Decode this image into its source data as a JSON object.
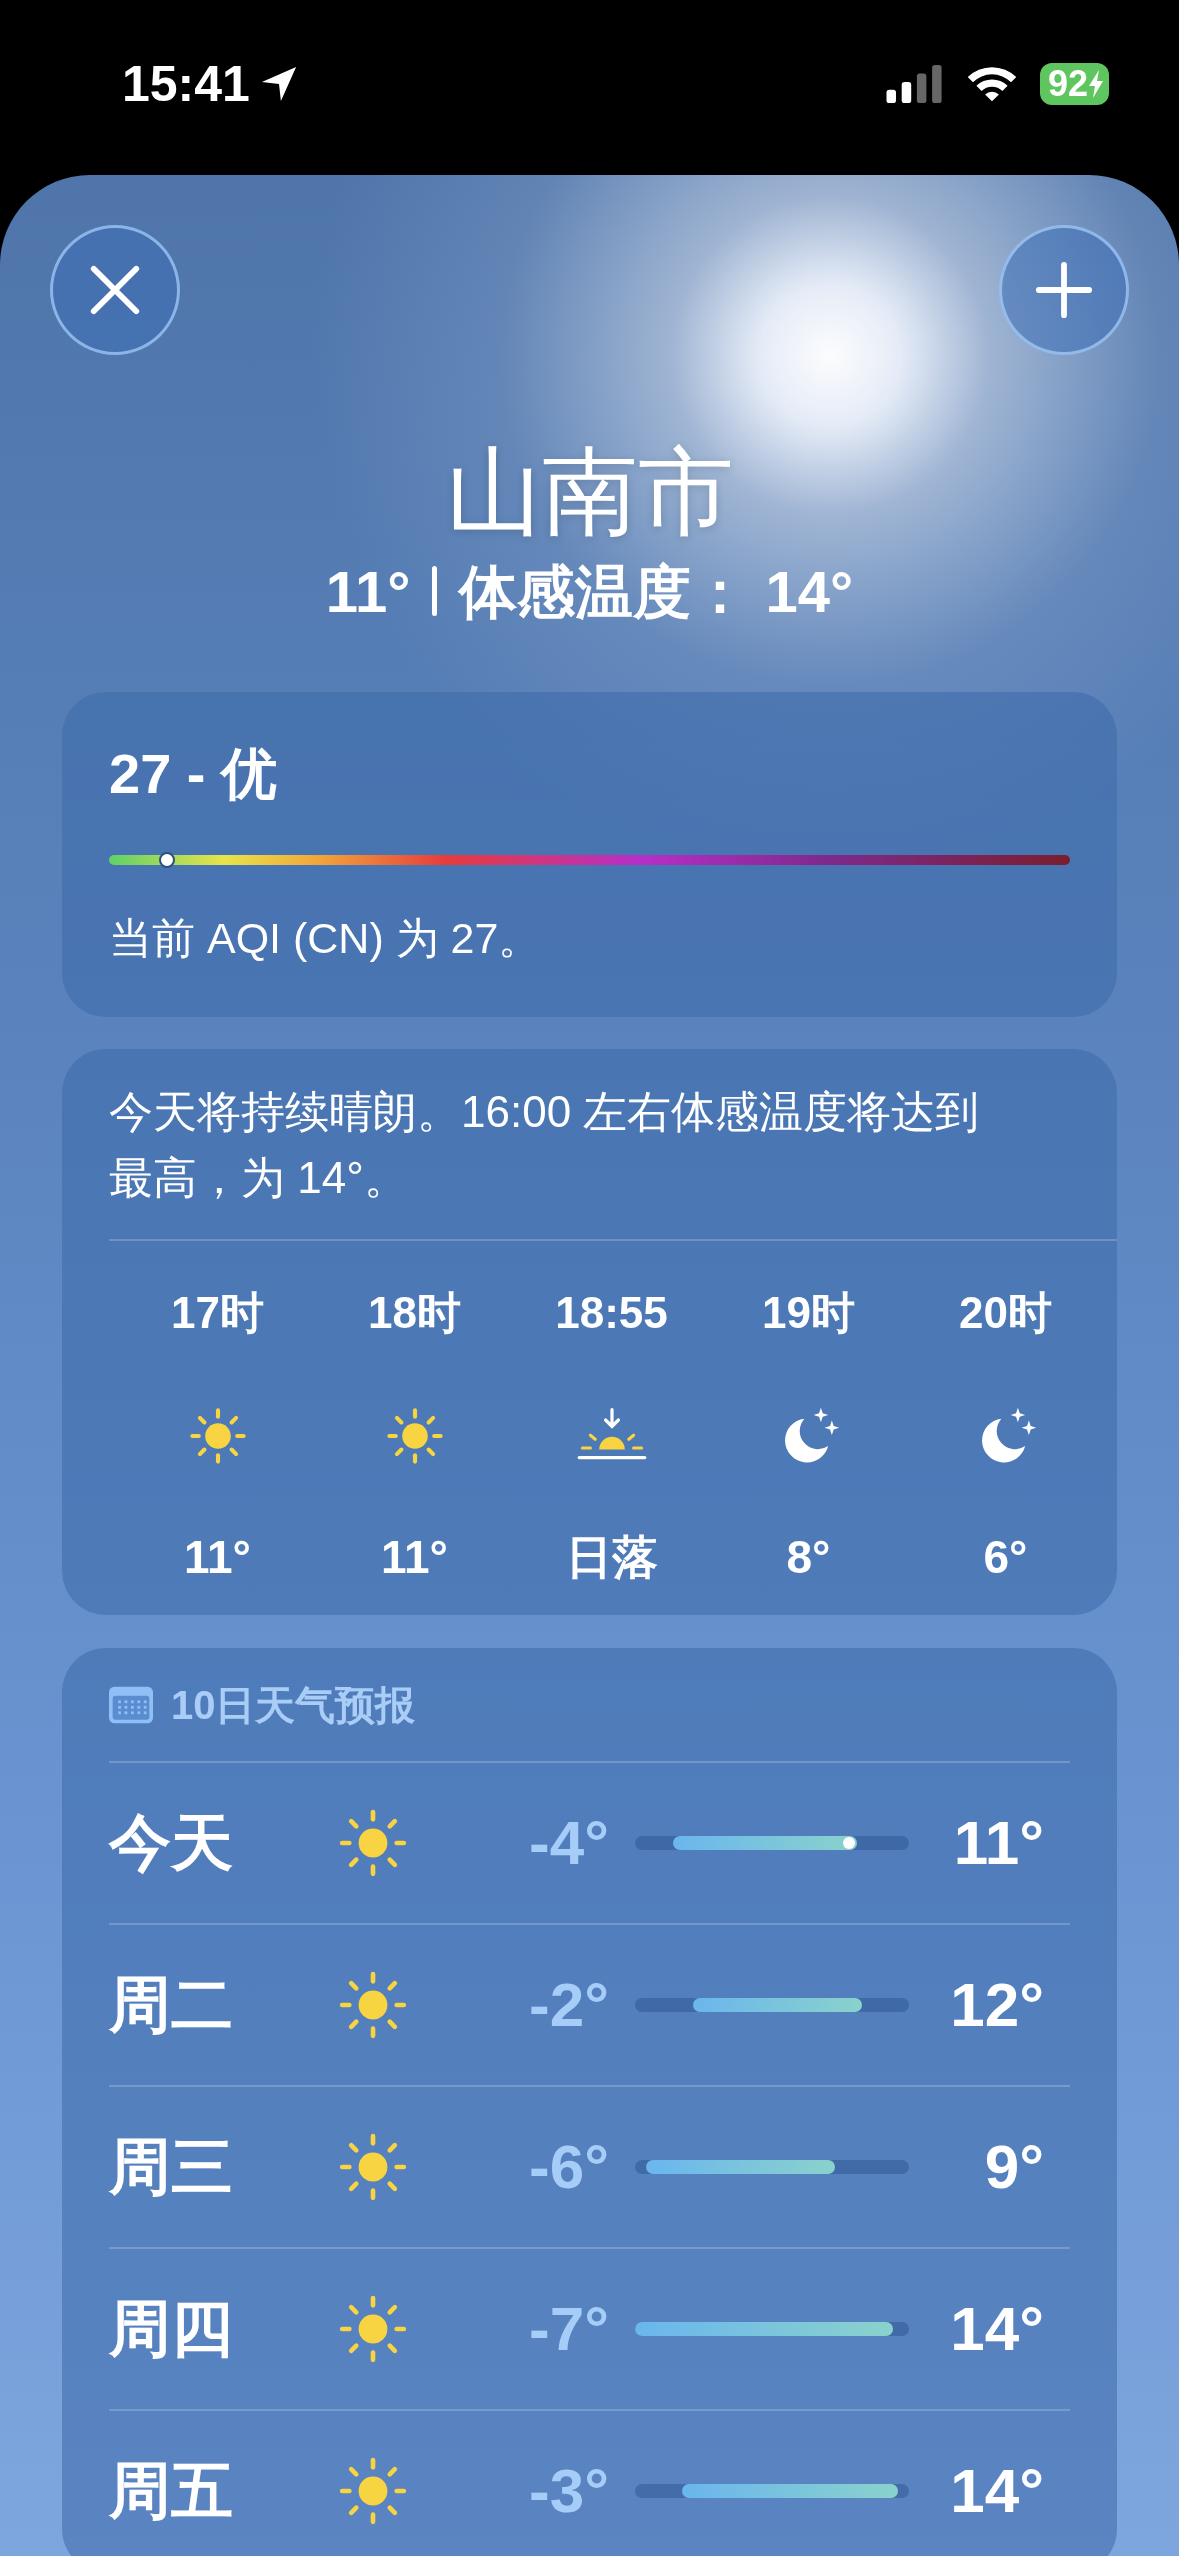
{
  "status_bar": {
    "time": "15:41",
    "battery": "92"
  },
  "location": {
    "city": "山南市",
    "temperature": "11°",
    "feels_like": "体感温度： 14°"
  },
  "air_quality": {
    "reading": "27 - 优",
    "description": "当前 AQI (CN) 为 27。",
    "scale": {
      "level": 0.06
    }
  },
  "hourly": {
    "summary": "今天将持续晴朗。16:00 左右体感温度将达到最高，为 14°。",
    "hours": [
      {
        "time": "17时",
        "kind": "sun",
        "value": "11°"
      },
      {
        "time": "18时",
        "kind": "sun",
        "value": "11°"
      },
      {
        "time": "18:55",
        "kind": "sunset",
        "value": "日落"
      },
      {
        "time": "19时",
        "kind": "moon",
        "value": "8°"
      },
      {
        "time": "20时",
        "kind": "moon",
        "value": "6°"
      }
    ]
  },
  "forecast": {
    "title": "10日天气预报",
    "days": [
      {
        "day": "今天",
        "low": "-4°",
        "high": "11°",
        "current": {
          "level": 0.78
        }
      },
      {
        "day": "周二",
        "low": "-2°",
        "high": "12°"
      },
      {
        "day": "周三",
        "low": "-6°",
        "high": "9°"
      },
      {
        "day": "周四",
        "low": "-7°",
        "high": "14°"
      },
      {
        "day": "周五",
        "low": "-3°",
        "high": "14°"
      }
    ]
  }
}
